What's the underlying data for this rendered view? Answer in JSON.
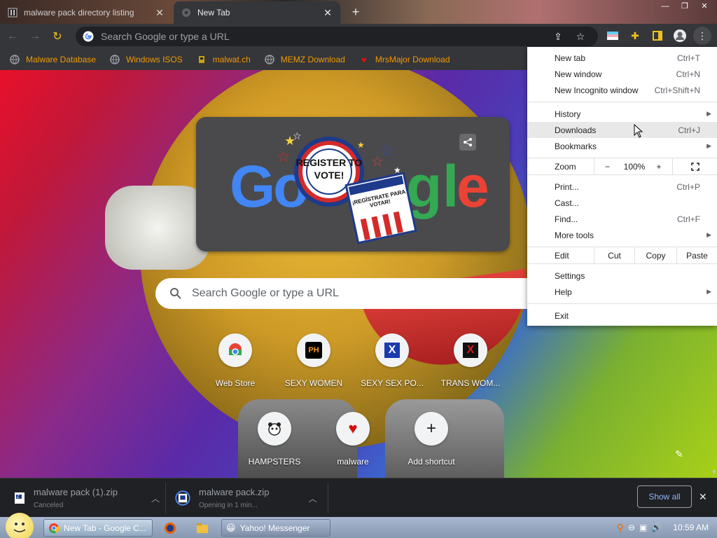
{
  "tabs": [
    {
      "title": "malware pack directory listing",
      "active": false
    },
    {
      "title": "New Tab",
      "active": true
    }
  ],
  "toolbar": {
    "omnibox_placeholder": "Search Google or type a URL"
  },
  "bookmarks": [
    {
      "label": "Malware Database",
      "icon": "globe-icon"
    },
    {
      "label": "Windows ISOS",
      "icon": "globe-icon"
    },
    {
      "label": "malwat.ch",
      "icon": "malwatch-icon"
    },
    {
      "label": "MEMZ Download",
      "icon": "globe-icon"
    },
    {
      "label": "MrsMajor Download",
      "icon": "heart-icon"
    }
  ],
  "ntp": {
    "search_placeholder": "Search Google or type a URL",
    "doodle_text_1": "REGISTER TO VOTE!",
    "doodle_text_2": "¡REGÍSTRATE PARA VOTAR!",
    "shortcuts": [
      {
        "label": "Web Store",
        "icon": "webstore-icon"
      },
      {
        "label": "SEXY WOMEN",
        "icon": "ph-icon"
      },
      {
        "label": "SEXY SEX PO...",
        "icon": "x-blue-icon"
      },
      {
        "label": "TRANS WOM...",
        "icon": "x-red-icon"
      },
      {
        "label": "HAMPSTERS",
        "icon": "hamster-icon"
      },
      {
        "label": "malware",
        "icon": "heart-icon"
      },
      {
        "label": "Add shortcut",
        "icon": "plus-icon"
      }
    ]
  },
  "menu": {
    "items1": [
      {
        "label": "New tab",
        "key": "Ctrl+T"
      },
      {
        "label": "New window",
        "key": "Ctrl+N"
      },
      {
        "label": "New Incognito window",
        "key": "Ctrl+Shift+N"
      }
    ],
    "items2": [
      {
        "label": "History",
        "key": "",
        "submenu": true
      },
      {
        "label": "Downloads",
        "key": "Ctrl+J",
        "submenu": false
      },
      {
        "label": "Bookmarks",
        "key": "",
        "submenu": true
      }
    ],
    "zoom": {
      "label": "Zoom",
      "minus": "−",
      "value": "100%",
      "plus": "+"
    },
    "items3": [
      {
        "label": "Print...",
        "key": "Ctrl+P",
        "submenu": false
      },
      {
        "label": "Cast...",
        "key": "",
        "submenu": false
      },
      {
        "label": "Find...",
        "key": "Ctrl+F",
        "submenu": false
      },
      {
        "label": "More tools",
        "key": "",
        "submenu": true
      }
    ],
    "edit": {
      "label": "Edit",
      "cut": "Cut",
      "copy": "Copy",
      "paste": "Paste"
    },
    "items4": [
      {
        "label": "Settings",
        "key": "",
        "submenu": false
      },
      {
        "label": "Help",
        "key": "",
        "submenu": true
      }
    ],
    "exit": "Exit"
  },
  "downloads": {
    "items": [
      {
        "name": "malware pack (1).zip",
        "status": "Canceled"
      },
      {
        "name": "malware pack.zip",
        "status": "Opening in 1 min..."
      }
    ],
    "show_all": "Show all"
  },
  "taskbar": {
    "tasks": [
      {
        "label": "New Tab - Google C...",
        "active": true
      },
      {
        "label": "Yahoo! Messenger",
        "active": false
      }
    ],
    "clock": "10:59 AM"
  },
  "colors": {
    "accent_blue": "#8ab4f8",
    "bookmark_text": "#f29900",
    "chrome_dark": "#35363a"
  }
}
